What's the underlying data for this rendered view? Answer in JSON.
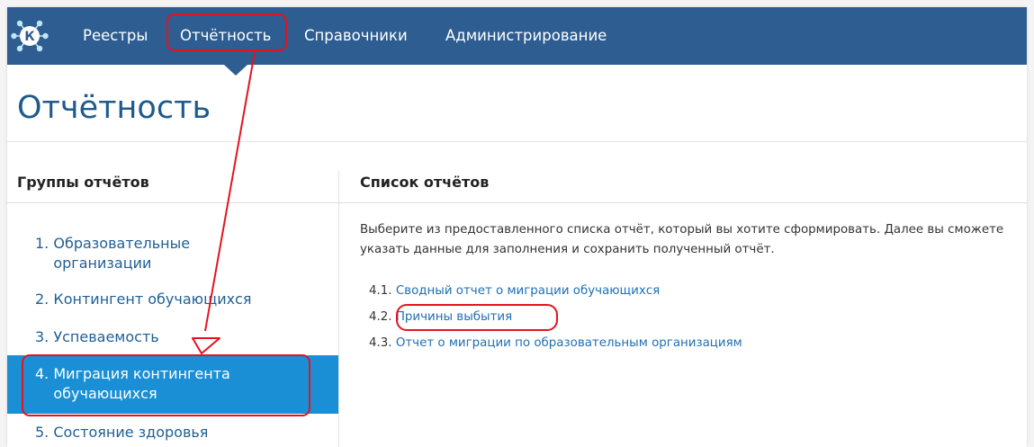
{
  "brand": {
    "logo_letter": "К"
  },
  "nav": {
    "items": [
      {
        "label": "Реестры"
      },
      {
        "label": "Отчётность"
      },
      {
        "label": "Справочники"
      },
      {
        "label": "Администрирование"
      }
    ]
  },
  "page": {
    "title": "Отчётность"
  },
  "groups": {
    "heading": "Группы отчётов",
    "items": [
      {
        "number": "1.",
        "label": "Образовательные организации"
      },
      {
        "number": "2.",
        "label": "Контингент обучающихся"
      },
      {
        "number": "3.",
        "label": "Успеваемость"
      },
      {
        "number": "4.",
        "label": "Миграция контингента обучающихся"
      },
      {
        "number": "5.",
        "label": "Состояние здоровья"
      }
    ]
  },
  "reports": {
    "heading": "Список отчётов",
    "description": "Выберите из предоставленного списка отчёт, который вы хотите сформировать. Далее вы сможете указать данные для заполнения и сохранить полученный отчёт.",
    "items": [
      {
        "number": "4.1.",
        "label": "Сводный отчет о миграции обучающихся"
      },
      {
        "number": "4.2.",
        "label": "Причины выбытия"
      },
      {
        "number": "4.3.",
        "label": "Отчет о миграции по образовательным организациям"
      }
    ]
  },
  "colors": {
    "nav_bg": "#2e5d92",
    "active_bg": "#1a8fd6",
    "link": "#1f6fb2",
    "annotation": "#e3141e"
  }
}
